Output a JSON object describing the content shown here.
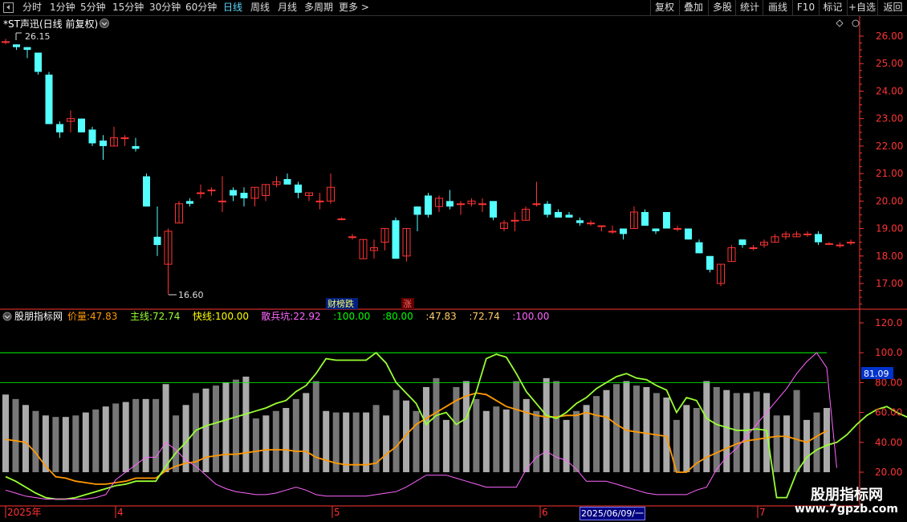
{
  "toolbar": {
    "left": [
      "分时",
      "1分钟",
      "5分钟",
      "15分钟",
      "30分钟",
      "60分钟",
      "日线",
      "周线",
      "月线",
      "多周期",
      "更多 >"
    ],
    "active": "日线",
    "right": [
      "复权",
      "叠加",
      "多股",
      "统计",
      "画线",
      "F10",
      "+自选",
      "返回"
    ],
    "extra": "标记"
  },
  "stock": {
    "title": "*ST声迅(日线 前复权)"
  },
  "price_axis": {
    "labels": [
      "26.00",
      "25.00",
      "24.00",
      "23.00",
      "22.00",
      "21.00",
      "20.00",
      "19.00",
      "18.00",
      "17.00"
    ],
    "ylim": [
      16.6,
      26.3
    ]
  },
  "markers": {
    "high": "26.15",
    "low": "16.60",
    "event1": "财榜跌",
    "event2": "涨"
  },
  "indicator": {
    "name": "股朋指标网",
    "items": [
      {
        "label": "价量:",
        "value": "47.83",
        "color": "#ff9900"
      },
      {
        "label": "主线:",
        "value": "72.74",
        "color": "#99ff33"
      },
      {
        "label": "快线:",
        "value": "100.00",
        "color": "#ffff00"
      },
      {
        "label": "散兵坑:",
        "value": "22.92",
        "color": "#ff66ff"
      },
      {
        "label": ":",
        "value": "100.00",
        "color": "#00ff00"
      },
      {
        "label": ":",
        "value": "80.00",
        "color": "#00ff00"
      },
      {
        "label": ":",
        "value": "47.83",
        "color": "#ffcc66"
      },
      {
        "label": ":",
        "value": "72.74",
        "color": "#ffcc66"
      },
      {
        "label": ":",
        "value": "100.00",
        "color": "#ff66ff"
      }
    ],
    "axis_labels": [
      "120.0",
      "100.0",
      "80.00",
      "60.00",
      "40.00",
      "20.00"
    ],
    "current": "81.09"
  },
  "time_axis": {
    "labels": [
      "2025年",
      "4",
      "5",
      "6",
      "7"
    ],
    "cursor": "2025/06/09/一"
  },
  "watermark": {
    "name": "股朋指标网",
    "url": "www.7gpzb.com"
  },
  "colors": {
    "up": "#ff3333",
    "down": "#54ffff",
    "grid": "#800000",
    "axis": "#ff3333"
  },
  "chart_data": [
    {
      "type": "candlestick",
      "title": "*ST声迅(日线 前复权)",
      "ylim": [
        16.6,
        26.3
      ],
      "candles": [
        [
          25.8,
          25.9,
          25.7,
          25.8
        ],
        [
          25.7,
          25.7,
          25.5,
          25.6
        ],
        [
          25.6,
          25.6,
          25.2,
          25.5
        ],
        [
          25.4,
          25.4,
          24.6,
          24.7
        ],
        [
          24.6,
          24.7,
          22.8,
          22.8
        ],
        [
          22.8,
          22.9,
          22.3,
          22.5
        ],
        [
          22.9,
          23.3,
          22.5,
          23.0
        ],
        [
          23.0,
          23.0,
          22.5,
          22.5
        ],
        [
          22.6,
          22.7,
          22.0,
          22.1
        ],
        [
          22.2,
          22.4,
          21.5,
          22.0
        ],
        [
          22.0,
          22.7,
          22.0,
          22.3
        ],
        [
          22.3,
          22.4,
          22.0,
          22.3
        ],
        [
          22.0,
          22.3,
          21.8,
          21.9
        ],
        [
          20.9,
          21.0,
          19.8,
          19.8
        ],
        [
          18.7,
          19.8,
          18.0,
          18.4
        ],
        [
          17.7,
          19.0,
          16.6,
          18.9
        ],
        [
          19.2,
          20.0,
          19.2,
          19.9
        ],
        [
          20.0,
          20.1,
          19.8,
          19.9
        ],
        [
          20.3,
          20.6,
          20.1,
          20.3
        ],
        [
          20.4,
          20.5,
          20.2,
          20.4
        ],
        [
          20.0,
          20.9,
          19.6,
          20.0
        ],
        [
          20.4,
          20.5,
          20.0,
          20.2
        ],
        [
          20.3,
          20.5,
          19.8,
          20.1
        ],
        [
          20.1,
          20.5,
          19.8,
          20.5
        ],
        [
          20.2,
          20.6,
          20.0,
          20.6
        ],
        [
          20.6,
          20.9,
          20.5,
          20.7
        ],
        [
          20.8,
          21.0,
          20.7,
          20.6
        ],
        [
          20.6,
          20.7,
          20.1,
          20.3
        ],
        [
          20.2,
          20.3,
          20.0,
          20.3
        ],
        [
          20.0,
          20.3,
          19.7,
          20.0
        ],
        [
          20.0,
          21.0,
          19.9,
          20.5
        ],
        [
          19.35,
          19.4,
          19.3,
          19.35
        ],
        [
          18.7,
          18.8,
          18.6,
          18.7
        ],
        [
          17.9,
          18.6,
          17.9,
          18.6
        ],
        [
          18.2,
          18.6,
          17.9,
          18.3
        ],
        [
          18.5,
          19.0,
          18.2,
          19.0
        ],
        [
          19.3,
          19.4,
          17.9,
          17.9
        ],
        [
          18.0,
          19.0,
          17.8,
          19.0
        ],
        [
          19.8,
          19.8,
          18.9,
          19.5
        ],
        [
          20.2,
          20.3,
          19.4,
          19.5
        ],
        [
          19.8,
          20.2,
          19.6,
          20.1
        ],
        [
          20.0,
          20.4,
          19.7,
          19.8
        ],
        [
          19.9,
          20.0,
          19.5,
          19.9
        ],
        [
          19.9,
          20.1,
          19.8,
          20.0
        ],
        [
          19.9,
          20.1,
          19.6,
          19.9
        ],
        [
          20.0,
          20.0,
          19.3,
          19.4
        ],
        [
          19.0,
          19.3,
          18.9,
          19.2
        ],
        [
          19.3,
          19.6,
          18.9,
          19.3
        ],
        [
          19.3,
          19.8,
          19.3,
          19.7
        ],
        [
          19.9,
          20.7,
          19.8,
          19.9
        ],
        [
          19.9,
          20.0,
          19.4,
          19.5
        ],
        [
          19.6,
          19.7,
          19.4,
          19.4
        ],
        [
          19.5,
          19.6,
          19.4,
          19.4
        ],
        [
          19.3,
          19.4,
          19.1,
          19.2
        ],
        [
          19.2,
          19.3,
          19.1,
          19.2
        ],
        [
          19.1,
          19.1,
          18.9,
          19.1
        ],
        [
          18.9,
          19.1,
          18.8,
          18.9
        ],
        [
          19.0,
          19.0,
          18.6,
          18.8
        ],
        [
          19.0,
          19.8,
          19.0,
          19.6
        ],
        [
          19.6,
          19.7,
          19.1,
          19.1
        ],
        [
          19.0,
          19.0,
          18.8,
          18.9
        ],
        [
          19.6,
          19.6,
          19.0,
          19.0
        ],
        [
          19.0,
          19.1,
          18.9,
          19.0
        ],
        [
          19.0,
          19.0,
          18.6,
          18.6
        ],
        [
          18.5,
          18.6,
          18.1,
          18.1
        ],
        [
          18.0,
          18.0,
          17.4,
          17.5
        ],
        [
          17.0,
          17.7,
          16.9,
          17.7
        ],
        [
          17.8,
          18.4,
          17.8,
          18.3
        ],
        [
          18.6,
          18.6,
          18.3,
          18.4
        ],
        [
          18.3,
          18.4,
          18.2,
          18.3
        ],
        [
          18.4,
          18.6,
          18.3,
          18.5
        ],
        [
          18.5,
          18.8,
          18.5,
          18.7
        ],
        [
          18.7,
          18.9,
          18.6,
          18.8
        ],
        [
          18.7,
          18.9,
          18.7,
          18.8
        ],
        [
          18.8,
          18.9,
          18.7,
          18.8
        ],
        [
          18.8,
          18.9,
          18.4,
          18.5
        ],
        [
          18.45,
          18.5,
          18.4,
          18.45
        ],
        [
          18.4,
          18.5,
          18.3,
          18.4
        ],
        [
          18.5,
          18.6,
          18.4,
          18.5
        ]
      ]
    },
    {
      "type": "line",
      "title": "股朋指标网",
      "ylim": [
        0,
        130
      ],
      "reference_lines": [
        100,
        80
      ],
      "series": [
        {
          "name": "价量",
          "color": "#ff9900",
          "values": [
            42,
            41,
            40,
            33,
            24,
            17,
            16,
            14,
            13,
            12,
            12,
            13,
            14,
            16,
            16,
            16,
            21,
            24,
            26,
            27,
            30,
            31,
            32,
            32,
            33,
            34,
            35,
            35,
            35,
            34,
            34,
            30,
            28,
            26,
            25,
            25,
            25,
            26,
            32,
            37,
            45,
            52,
            56,
            60,
            64,
            68,
            71,
            73,
            72,
            68,
            64,
            62,
            60,
            58,
            57,
            57,
            58,
            58,
            60,
            58,
            57,
            52,
            48,
            47,
            46,
            45,
            44,
            20,
            20,
            26,
            30,
            33,
            36,
            39,
            41,
            42,
            43,
            44,
            44,
            42,
            40,
            44,
            47.8
          ]
        },
        {
          "name": "主线",
          "color": "#99ff33",
          "values": [
            17,
            14,
            10,
            6,
            3,
            2,
            2,
            3,
            5,
            7,
            9,
            11,
            12,
            14,
            14,
            14,
            24,
            33,
            40,
            48,
            51,
            53,
            55,
            57,
            59,
            61,
            63,
            66,
            68,
            74,
            78,
            86,
            96,
            95,
            95,
            95,
            95,
            100,
            93,
            80,
            73,
            66,
            52,
            58,
            60,
            52,
            56,
            74,
            96,
            99,
            97,
            86,
            74,
            66,
            58,
            56,
            60,
            66,
            70,
            76,
            80,
            84,
            86,
            83,
            82,
            78,
            75,
            60,
            70,
            68,
            56,
            52,
            50,
            48,
            48,
            49,
            48,
            3,
            3,
            20,
            30,
            35,
            38,
            40,
            45,
            52,
            58,
            62,
            64,
            60,
            57,
            54,
            62,
            72.7
          ]
        },
        {
          "name": "散兵坑",
          "color": "#ff66ff",
          "values": [
            8,
            6,
            4,
            3,
            2,
            2,
            2,
            2,
            2,
            3,
            5,
            15,
            20,
            25,
            30,
            30,
            40,
            35,
            28,
            24,
            18,
            12,
            9,
            7,
            6,
            5,
            5,
            6,
            8,
            10,
            8,
            5,
            4,
            4,
            4,
            4,
            4,
            5,
            6,
            7,
            10,
            14,
            18,
            18,
            18,
            16,
            14,
            12,
            10,
            10,
            10,
            10,
            22,
            30,
            34,
            30,
            28,
            22,
            14,
            14,
            14,
            12,
            10,
            8,
            6,
            5,
            5,
            5,
            5,
            8,
            10,
            22,
            30,
            36,
            44,
            52,
            60,
            68,
            76,
            86,
            94,
            100,
            90,
            22.9
          ]
        }
      ]
    }
  ]
}
